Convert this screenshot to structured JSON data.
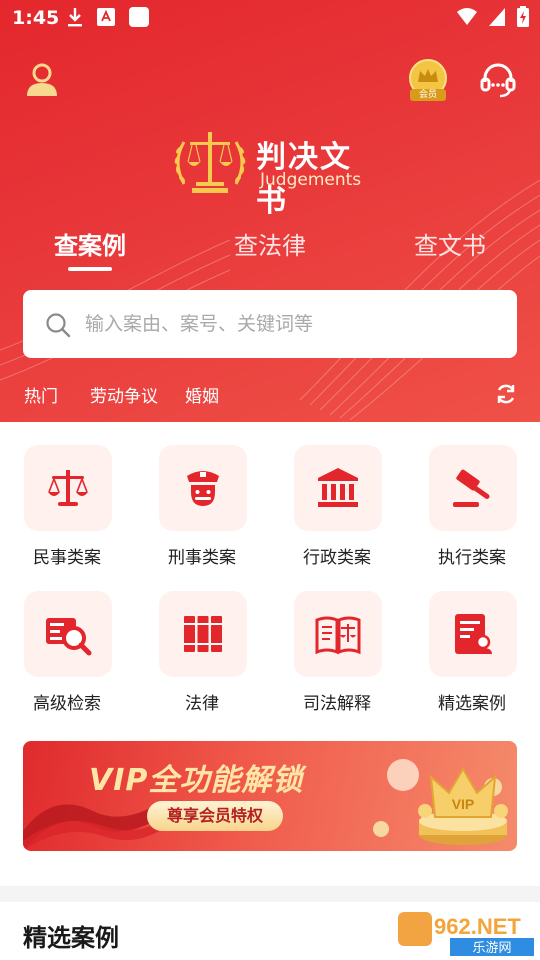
{
  "status": {
    "time": "1:45"
  },
  "logo": {
    "title": "判决文书",
    "subtitle": "Judgements"
  },
  "vip_badge": {
    "label": "会员"
  },
  "tabs": [
    {
      "label": "查案例",
      "active": true
    },
    {
      "label": "查法律",
      "active": false
    },
    {
      "label": "查文书",
      "active": false
    }
  ],
  "search": {
    "placeholder": "输入案由、案号、关键词等"
  },
  "hot": {
    "label": "热门",
    "tags": [
      "劳动争议",
      "婚姻"
    ]
  },
  "categories": [
    {
      "label": "民事类案",
      "icon": "scales-icon"
    },
    {
      "label": "刑事类案",
      "icon": "police-icon"
    },
    {
      "label": "行政类案",
      "icon": "government-building-icon"
    },
    {
      "label": "执行类案",
      "icon": "gavel-icon"
    },
    {
      "label": "高级检索",
      "icon": "advanced-search-icon"
    },
    {
      "label": "法律",
      "icon": "law-books-icon"
    },
    {
      "label": "司法解释",
      "icon": "open-book-scales-icon"
    },
    {
      "label": "精选案例",
      "icon": "case-document-icon"
    }
  ],
  "banner": {
    "title": "VIP全功能解锁",
    "button": "尊享会员特权",
    "crown_text": "VIP"
  },
  "section": {
    "title": "精选案例"
  },
  "watermark": {
    "text_top": "962.NET",
    "text_bottom": "乐游网"
  },
  "colors": {
    "brand_red": "#e3272d",
    "icon_red": "#e3262b",
    "tile_bg": "#fff1ee",
    "gold": "#f4c542"
  }
}
